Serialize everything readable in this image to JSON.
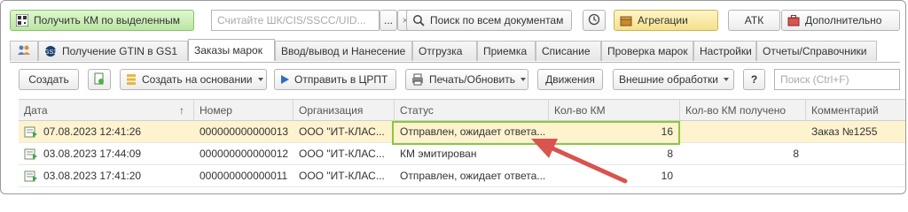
{
  "toolbar_top": {
    "get_km_label": "Получить КМ по выделенным",
    "barcode_placeholder": "Считайте ШК/CIS/SSCC/UID...",
    "browse_label": "...",
    "clear_label": "×",
    "search_all_label": "Поиск по всем документам",
    "aggregation_label": "Агрегации",
    "atk_label": "АТК",
    "more_label": "Дополнительно"
  },
  "tabs": [
    {
      "label": ""
    },
    {
      "label": "Получение GTIN в GS1"
    },
    {
      "label": "Заказы марок"
    },
    {
      "label": "Ввод/вывод и Нанесение"
    },
    {
      "label": "Отгрузка"
    },
    {
      "label": "Приемка"
    },
    {
      "label": "Списание"
    },
    {
      "label": "Проверка марок"
    },
    {
      "label": "Настройки"
    },
    {
      "label": "Отчеты/Справочники"
    }
  ],
  "toolbar_doc": {
    "create_label": "Создать",
    "create_based_label": "Создать на основании",
    "send_label": "Отправить в ЦРПТ",
    "print_label": "Печать/Обновить",
    "movements_label": "Движения",
    "external_label": "Внешние обработки",
    "help_label": "?",
    "search_placeholder": "Поиск (Ctrl+F)"
  },
  "table": {
    "columns": [
      "Дата",
      "Номер",
      "Организация",
      "Статус",
      "Кол-во КМ",
      "Кол-во КМ получено",
      "Комментарий"
    ],
    "sort_indicator": "↑",
    "rows": [
      {
        "date": "07.08.2023 12:41:26",
        "number": "000000000000013",
        "org": "ООО \"ИТ-КЛАС...",
        "status": "Отправлен, ожидает ответа...",
        "qty": "16",
        "qty_received": "",
        "comment": "Заказ №1255"
      },
      {
        "date": "03.08.2023 17:44:09",
        "number": "000000000000012",
        "org": "ООО \"ИТ-КЛАС...",
        "status": "КМ эмитирован",
        "qty": "8",
        "qty_received": "8",
        "comment": ""
      },
      {
        "date": "03.08.2023 17:41:20",
        "number": "000000000000011",
        "org": "ООО \"ИТ-КЛАС...",
        "status": "Отправлен, ожидает ответа...",
        "qty": "10",
        "qty_received": "",
        "comment": ""
      }
    ]
  },
  "colors": {
    "highlight": "#8dc63f",
    "arrow": "#d9534f",
    "selected_row": "#fdf3cf"
  }
}
